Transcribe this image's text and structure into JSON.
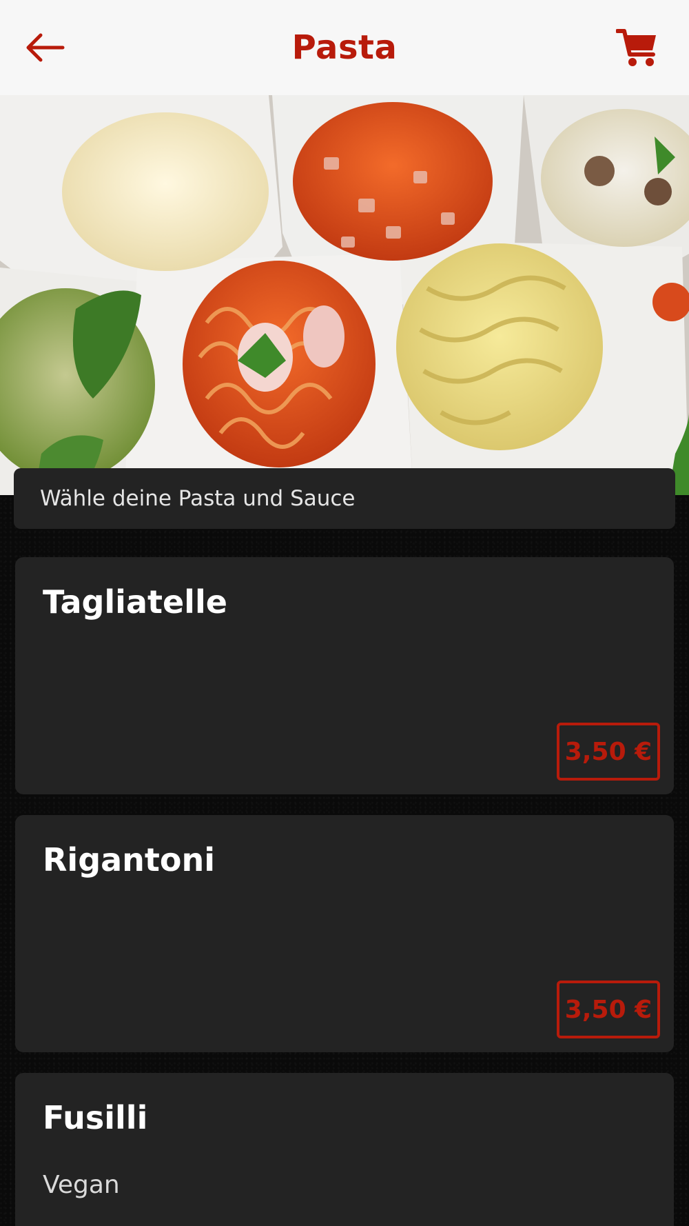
{
  "header": {
    "title": "Pasta",
    "back_icon": "arrow-left-icon",
    "cart_icon": "shopping-cart-icon"
  },
  "colors": {
    "accent": "#b81b0b",
    "header_bg": "#f7f7f7",
    "card_bg": "#232323",
    "page_bg": "#0a0a0a"
  },
  "subtitle": "Wähle deine Pasta und Sauce",
  "items": [
    {
      "name": "Tagliatelle",
      "description": "",
      "price": "3,50 €"
    },
    {
      "name": "Rigantoni",
      "description": "",
      "price": "3,50 €"
    },
    {
      "name": "Fusilli",
      "description": "Vegan",
      "price": ""
    }
  ]
}
